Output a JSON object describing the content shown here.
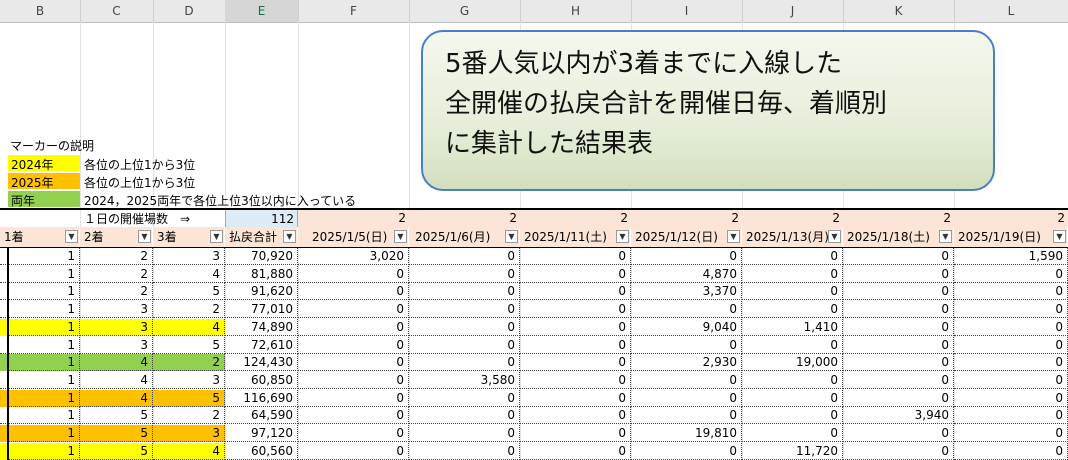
{
  "columns": [
    "B",
    "C",
    "D",
    "E",
    "F",
    "G",
    "H",
    "I",
    "J",
    "K",
    "L"
  ],
  "legend": {
    "title": "マーカーの説明",
    "items": [
      {
        "label": "2024年",
        "desc": "各位の上位1から3位",
        "color": "#ffff00"
      },
      {
        "label": "2025年",
        "desc": "各位の上位1から3位",
        "color": "#ffc000"
      },
      {
        "label": "両年",
        "desc": "2024，2025両年で各位上位3位以内に入っている",
        "color": "#92d050"
      }
    ]
  },
  "days_label": "１日の開催場数　⇒",
  "days_count": {
    "total": "112",
    "per_date": [
      "2",
      "2",
      "2",
      "2",
      "2",
      "2",
      "2"
    ]
  },
  "headers": {
    "first": "1着",
    "second": "2着",
    "third": "3着",
    "total": "払戻合計",
    "dates": [
      "2025/1/5(日)",
      "2025/1/6(月)",
      "2025/1/11(土)",
      "2025/1/12(日)",
      "2025/1/13(月)",
      "2025/1/18(土)",
      "2025/1/19(日)"
    ]
  },
  "rows": [
    {
      "a": "1",
      "b": "2",
      "c": "3",
      "total": "70,920",
      "d": [
        "3,020",
        "0",
        "0",
        "0",
        "0",
        "0",
        "1,590"
      ],
      "hl": ""
    },
    {
      "a": "1",
      "b": "2",
      "c": "4",
      "total": "81,880",
      "d": [
        "0",
        "0",
        "0",
        "4,870",
        "0",
        "0",
        "0"
      ],
      "hl": ""
    },
    {
      "a": "1",
      "b": "2",
      "c": "5",
      "total": "91,620",
      "d": [
        "0",
        "0",
        "0",
        "3,370",
        "0",
        "0",
        "0"
      ],
      "hl": ""
    },
    {
      "a": "1",
      "b": "3",
      "c": "2",
      "total": "77,010",
      "d": [
        "0",
        "0",
        "0",
        "0",
        "0",
        "0",
        "0"
      ],
      "hl": ""
    },
    {
      "a": "1",
      "b": "3",
      "c": "4",
      "total": "74,890",
      "d": [
        "0",
        "0",
        "0",
        "9,040",
        "1,410",
        "0",
        "0"
      ],
      "hl": "#ffff00"
    },
    {
      "a": "1",
      "b": "3",
      "c": "5",
      "total": "72,610",
      "d": [
        "0",
        "0",
        "0",
        "0",
        "0",
        "0",
        "0"
      ],
      "hl": ""
    },
    {
      "a": "1",
      "b": "4",
      "c": "2",
      "total": "124,430",
      "d": [
        "0",
        "0",
        "0",
        "2,930",
        "19,000",
        "0",
        "0"
      ],
      "hl": "#92d050"
    },
    {
      "a": "1",
      "b": "4",
      "c": "3",
      "total": "60,850",
      "d": [
        "0",
        "3,580",
        "0",
        "0",
        "0",
        "0",
        "0"
      ],
      "hl": ""
    },
    {
      "a": "1",
      "b": "4",
      "c": "5",
      "total": "116,690",
      "d": [
        "0",
        "0",
        "0",
        "0",
        "0",
        "0",
        "0"
      ],
      "hl": "#ffc000"
    },
    {
      "a": "1",
      "b": "5",
      "c": "2",
      "total": "64,590",
      "d": [
        "0",
        "0",
        "0",
        "0",
        "0",
        "3,940",
        "0"
      ],
      "hl": ""
    },
    {
      "a": "1",
      "b": "5",
      "c": "3",
      "total": "97,120",
      "d": [
        "0",
        "0",
        "0",
        "19,810",
        "0",
        "0",
        "0"
      ],
      "hl": "#ffc000"
    },
    {
      "a": "1",
      "b": "5",
      "c": "4",
      "total": "60,560",
      "d": [
        "0",
        "0",
        "0",
        "0",
        "11,720",
        "0",
        "0"
      ],
      "hl": "#ffff00"
    }
  ],
  "callout": {
    "lines": [
      "5番人気以内が3着までに入線した",
      "全開催の払戻合計を開催日毎、着順別",
      "に集計した結果表"
    ]
  },
  "colors": {
    "header_fill": "#fce4d6",
    "selected_cell": "#ddebf7",
    "callout_border": "#4a7ec9"
  }
}
